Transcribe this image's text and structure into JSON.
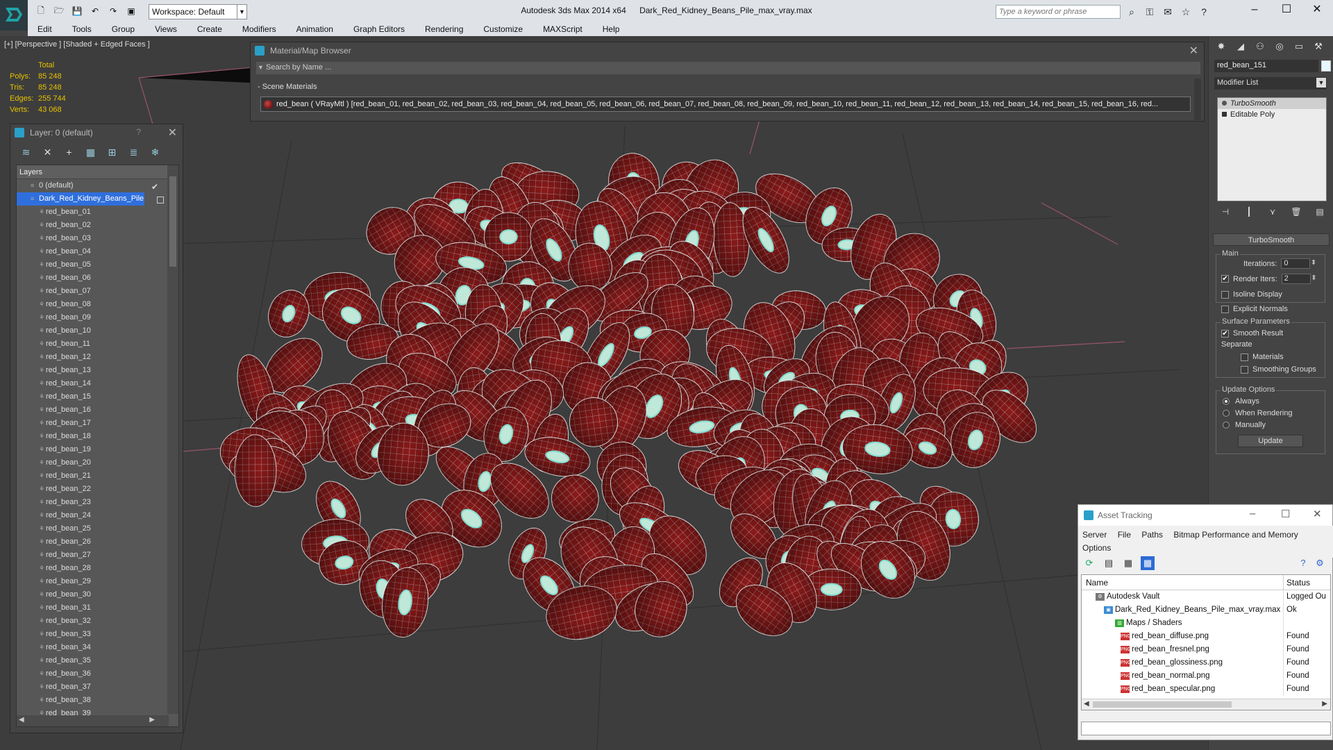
{
  "titlebar": {
    "app": "Autodesk 3ds Max  2014 x64",
    "file": "Dark_Red_Kidney_Beans_Pile_max_vray.max",
    "workspace": "Workspace: Default",
    "search_placeholder": "Type a keyword or phrase"
  },
  "menu": [
    "Edit",
    "Tools",
    "Group",
    "Views",
    "Create",
    "Modifiers",
    "Animation",
    "Graph Editors",
    "Rendering",
    "Customize",
    "MAXScript",
    "Help"
  ],
  "viewport": {
    "label": "[+] [Perspective ] [Shaded + Edged Faces ]",
    "stats": {
      "header": "Total",
      "rows": [
        {
          "k": "Polys:",
          "v": "85 248"
        },
        {
          "k": "Tris:",
          "v": "85 248"
        },
        {
          "k": "Edges:",
          "v": "255 744"
        },
        {
          "k": "Verts:",
          "v": "43 068"
        }
      ]
    }
  },
  "material_browser": {
    "title": "Material/Map Browser",
    "search": "Search by Name ...",
    "section": "- Scene Materials",
    "row": "red_bean  ( VRayMtl )  [red_bean_01, red_bean_02, red_bean_03, red_bean_04, red_bean_05, red_bean_06, red_bean_07, red_bean_08, red_bean_09, red_bean_10, red_bean_11, red_bean_12, red_bean_13, red_bean_14, red_bean_15, red_bean_16, red..."
  },
  "layers": {
    "title": "Layer: 0 (default)",
    "help": "?",
    "header": "Layers",
    "default_layer": "0 (default)",
    "selected_layer": "Dark_Red_Kidney_Beans_Pile",
    "objects": [
      "red_bean_01",
      "red_bean_02",
      "red_bean_03",
      "red_bean_04",
      "red_bean_05",
      "red_bean_06",
      "red_bean_07",
      "red_bean_08",
      "red_bean_09",
      "red_bean_10",
      "red_bean_11",
      "red_bean_12",
      "red_bean_13",
      "red_bean_14",
      "red_bean_15",
      "red_bean_16",
      "red_bean_17",
      "red_bean_18",
      "red_bean_19",
      "red_bean_20",
      "red_bean_21",
      "red_bean_22",
      "red_bean_23",
      "red_bean_24",
      "red_bean_25",
      "red_bean_26",
      "red_bean_27",
      "red_bean_28",
      "red_bean_29",
      "red_bean_30",
      "red_bean_31",
      "red_bean_32",
      "red_bean_33",
      "red_bean_34",
      "red_bean_35",
      "red_bean_36",
      "red_bean_37",
      "red_bean_38",
      "red_bean_39"
    ]
  },
  "command_panel": {
    "object_name": "red_bean_151",
    "modifier_list": "Modifier List",
    "stack": [
      "TurboSmooth",
      "Editable Poly"
    ],
    "turbosmooth": {
      "title": "TurboSmooth",
      "main": "Main",
      "iterations_label": "Iterations:",
      "iterations": "0",
      "render_iters_label": "Render Iters:",
      "render_iters": "2",
      "isoline": "Isoline Display",
      "explicit": "Explicit Normals",
      "surface": "Surface Parameters",
      "smooth_result": "Smooth Result",
      "separate": "Separate",
      "materials": "Materials",
      "smoothing_groups": "Smoothing Groups",
      "update_options": "Update Options",
      "always": "Always",
      "when_rendering": "When Rendering",
      "manually": "Manually",
      "update": "Update"
    }
  },
  "asset_tracking": {
    "title": "Asset Tracking",
    "menu1": [
      "Server",
      "File",
      "Paths",
      "Bitmap Performance and Memory"
    ],
    "menu2": "Options",
    "col_name": "Name",
    "col_status": "Status",
    "rows": [
      {
        "name": "Autodesk Vault",
        "status": "Logged Ou"
      },
      {
        "name": "Dark_Red_Kidney_Beans_Pile_max_vray.max",
        "status": "Ok"
      },
      {
        "name": "Maps / Shaders",
        "status": ""
      },
      {
        "name": "red_bean_diffuse.png",
        "status": "Found"
      },
      {
        "name": "red_bean_fresnel.png",
        "status": "Found"
      },
      {
        "name": "red_bean_glossiness.png",
        "status": "Found"
      },
      {
        "name": "red_bean_normal.png",
        "status": "Found"
      },
      {
        "name": "red_bean_specular.png",
        "status": "Found"
      }
    ]
  }
}
